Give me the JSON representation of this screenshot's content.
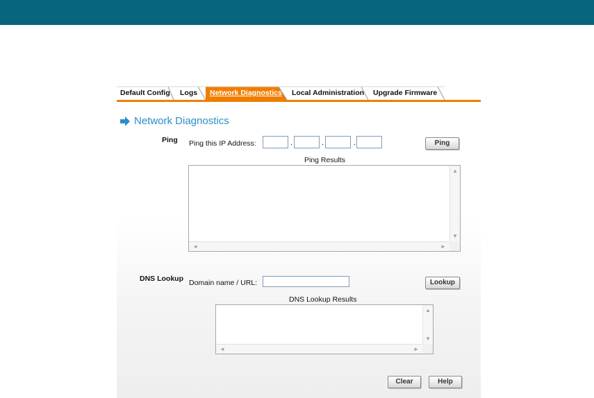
{
  "tabs": [
    {
      "label": "Default Config",
      "active": false
    },
    {
      "label": "Logs",
      "active": false
    },
    {
      "label": "Network Diagnostics",
      "active": true
    },
    {
      "label": "Local Administration",
      "active": false
    },
    {
      "label": "Upgrade Firmware",
      "active": false
    }
  ],
  "colors": {
    "header": "#07657d",
    "accent": "#f07d00",
    "title": "#2a8fc6"
  },
  "page": {
    "title": "Network Diagnostics",
    "title_icon": "right-arrow-icon"
  },
  "ping": {
    "section_label": "Ping",
    "ip_label": "Ping this IP Address:",
    "octets": [
      "",
      "",
      "",
      ""
    ],
    "separator": ".",
    "button_label": "Ping",
    "results_label": "Ping Results",
    "results_text": ""
  },
  "dns": {
    "section_label": "DNS Lookup",
    "domain_label": "Domain name / URL:",
    "domain_value": "",
    "button_label": "Lookup",
    "results_label": "DNS Lookup Results",
    "results_text": ""
  },
  "footer": {
    "clear_label": "Clear",
    "help_label": "Help"
  },
  "scroll_arrows": {
    "up": "▲",
    "down": "▼",
    "left": "◄",
    "right": "►"
  }
}
